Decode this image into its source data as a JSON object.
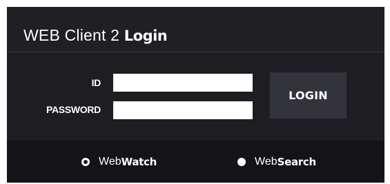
{
  "header": {
    "title_prefix": "WEB Client 2 ",
    "title_bold": "Login"
  },
  "form": {
    "id_label": "ID",
    "id_value": "",
    "password_label": "PASSWORD",
    "password_value": "",
    "login_label": "LOGIN"
  },
  "modes": [
    {
      "prefix": "Web",
      "bold": "Watch",
      "selected": true
    },
    {
      "prefix": "Web",
      "bold": "Search",
      "selected": false
    }
  ],
  "colors": {
    "panel": "#1f1f24",
    "footer": "#141418",
    "button": "#33333b",
    "text": "#ffffff"
  }
}
